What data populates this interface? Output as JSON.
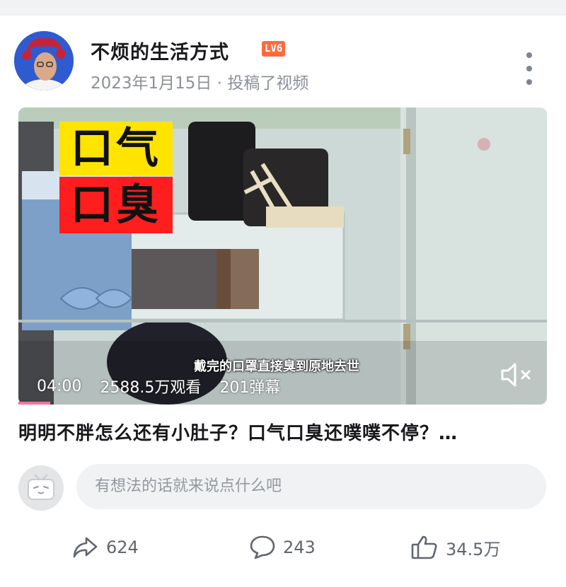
{
  "post": {
    "author_name": "不烦的生活方式",
    "level_badge": "LV6",
    "meta": "2023年1月15日 · 投稿了视频"
  },
  "video": {
    "tag_top": "口气",
    "tag_bottom": "口臭",
    "subtitle": "戴完的口罩直接臭到原地去世",
    "duration": "04:00",
    "views": "2588.5万观看",
    "danmaku": "201弹幕",
    "mute_icon": "speaker-muted-icon",
    "progress_fraction": 0.06
  },
  "title": "明明不胖怎么还有小肚子？口气口臭还噗噗不停？…",
  "comment": {
    "placeholder": "有想法的话就来说点什么吧"
  },
  "actions": {
    "share_count": "624",
    "comment_count": "243",
    "like_count": "34.5万"
  },
  "colors": {
    "accent_pink": "#fb7299",
    "level_orange": "#ff6a3d",
    "tag_yellow": "#ffe400",
    "tag_red": "#ff1e1e"
  }
}
